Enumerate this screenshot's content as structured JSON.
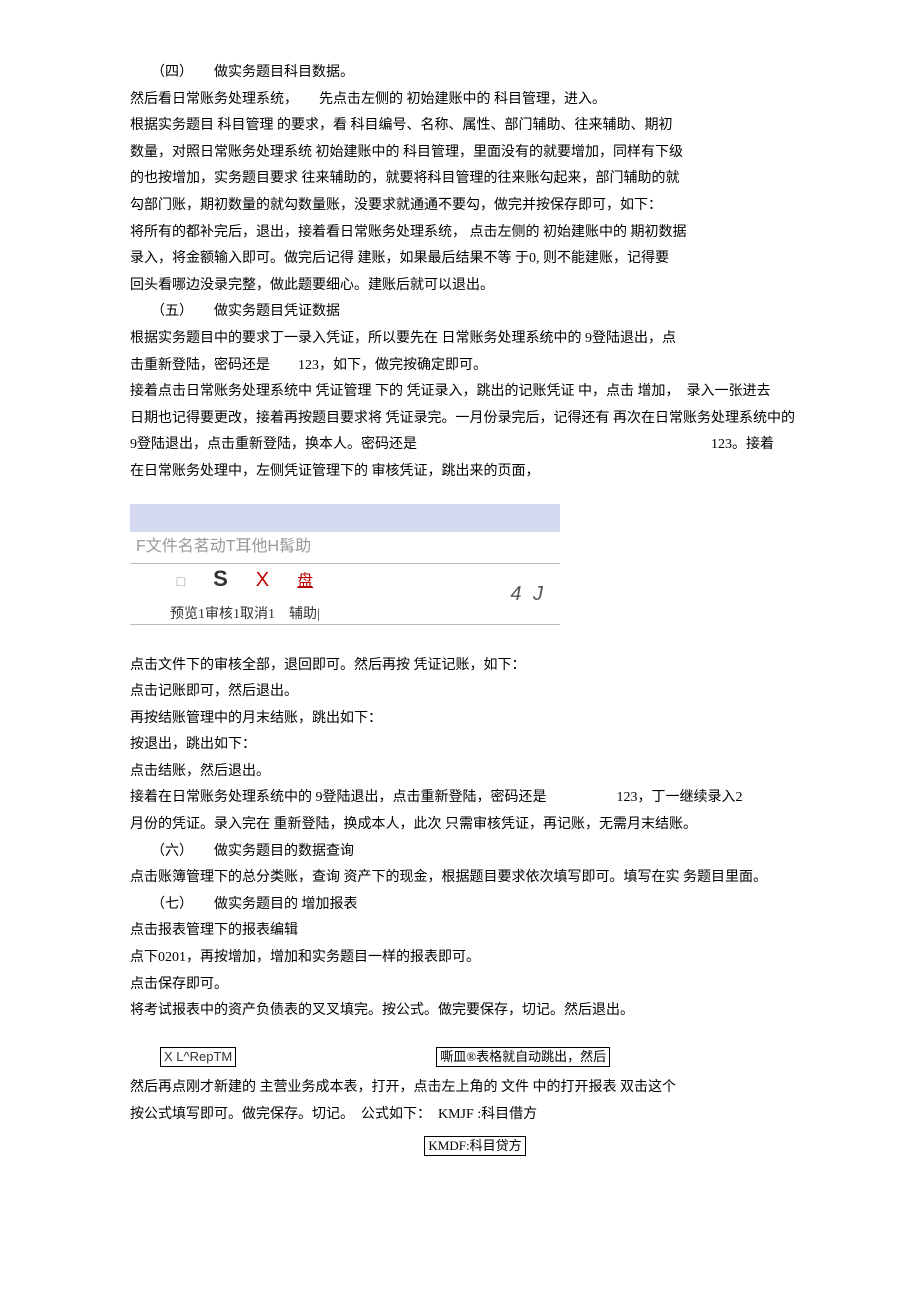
{
  "section4": {
    "heading": "（四）　　做实务题目科目数据。",
    "p1": "然后看日常账务处理系统，　　先点击左侧的 初始建账中的 科目管理，进入。",
    "p2": "根据实务题目 科目管理 的要求，看 科目编号、名称、属性、部门辅助、往来辅助、期初",
    "p3": "数量，对照日常账务处理系统 初始建账中的 科目管理，里面没有的就要增加，同样有下级",
    "p4": "的也按增加，实务题目要求 往来辅助的，就要将科目管理的往来账勾起来，部门辅助的就",
    "p5": "勾部门账，期初数量的就勾数量账，没要求就通通不要勾，做完并按保存即可，如下：",
    "p6": "将所有的都补完后，退出，接着看日常账务处理系统， 点击左侧的 初始建账中的 期初数据",
    "p7": "录入，将金额输入即可。做完后记得 建账，如果最后结果不等 于0, 则不能建账，记得要",
    "p8": "回头看哪边没录完整，做此题要细心。建账后就可以退出。"
  },
  "section5": {
    "heading": "（五）　　做实务题目凭证数据",
    "p1": "根据实务题目中的要求丁一录入凭证，所以要先在 日常账务处理系统中的 9登陆退出，点",
    "p2": "击重新登陆，密码还是　　123，如下，做完按确定即可。",
    "p3": "接着点击日常账务处理系统中 凭证管理 下的 凭证录入，跳出的记账凭证 中，点击 增加，　录入一张进去",
    "p4": "日期也记得要更改，接着再按题目要求将 凭证录完。一月份录完后，记得还有 再次在日常账务处理系统中的",
    "p5": "9登陆退出，点击重新登陆，换本人。密码还是　　　　　　　　　　　　　　　　　　　　　123。接着",
    "p6": "在日常账务处理中，左侧凭证管理下的 审核凭证，跳出来的页面，"
  },
  "uibox": {
    "menu": "F文件名茗动T耳他H髯助",
    "glyph_sq": "□",
    "glyph_s": "S",
    "glyph_x": "X",
    "glyph_pan": "盘",
    "labels": "预览1审核1取消1　辅助|",
    "rightj": "4 J"
  },
  "after_ui": {
    "p1": "点击文件下的审核全部，退回即可。然后再按 凭证记账，如下：",
    "p2": "点击记账即可，然后退出。",
    "p3": "再按结账管理中的月末结账，跳出如下：",
    "p4": "按退出，跳出如下：",
    "p5": "点击结账，然后退出。",
    "p6": "接着在日常账务处理系统中的 9登陆退出，点击重新登陆，密码还是　　　　　123，丁一继续录入2",
    "p7": "月份的凭证。录入完在 重新登陆，换成本人，此次 只需审核凭证，再记账，无需月末结账。"
  },
  "section6": {
    "heading": "（六）　　做实务题目的数据查询",
    "p1": "点击账簿管理下的总分类账，查询 资产下的现金，根据题目要求依次填写即可。填写在实 务题目里面。"
  },
  "section7": {
    "heading": "（七）　　做实务题目的 增加报表",
    "p1": "点击报表管理下的报表编辑",
    "p2": "点下0201，再按增加，增加和实务题目一样的报表即可。",
    "p3": "点击保存即可。",
    "p4": "将考试报表中的资产负债表的叉叉填完。按公式。做完要保存，切记。然后退出。"
  },
  "boxes": {
    "left": "X L^RepTM",
    "right": "嘶皿®表格就自动跳出，然后"
  },
  "tail": {
    "p1": "然后再点刚才新建的 主营业务成本表，打开，点击左上角的 文件 中的打开报表 双击这个",
    "p2": "按公式填写即可。做完保存。切记。　公式如下：　KMJF :科目借方",
    "p3": "KMDF:科目贷方"
  }
}
